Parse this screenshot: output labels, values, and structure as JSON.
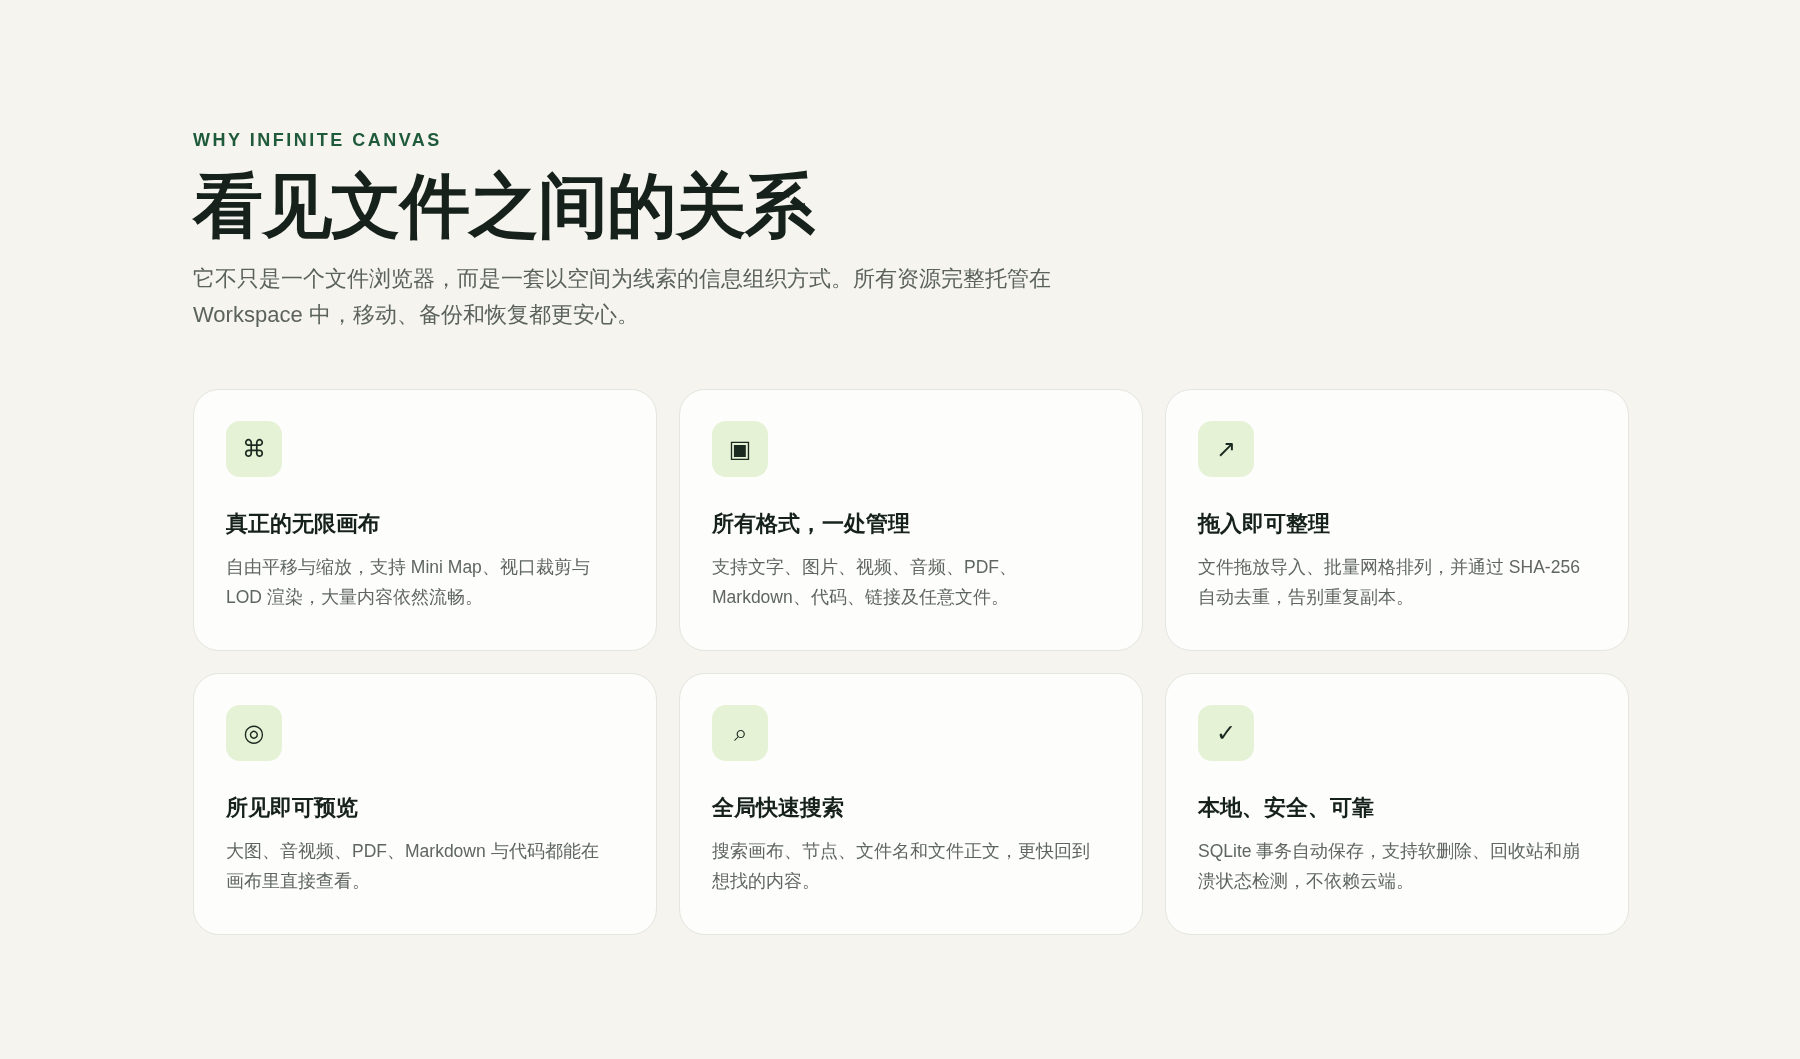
{
  "eyebrow": "WHY INFINITE CANVAS",
  "title": "看见文件之间的关系",
  "description": "它不只是一个文件浏览器，而是一套以空间为线索的信息组织方式。所有资源完整托管在 Workspace 中，移动、备份和恢复都更安心。",
  "features": [
    {
      "icon": "⌘",
      "title": "真正的无限画布",
      "text": "自由平移与缩放，支持 Mini Map、视口裁剪与 LOD 渲染，大量内容依然流畅。"
    },
    {
      "icon": "▣",
      "title": "所有格式，一处管理",
      "text": "支持文字、图片、视频、音频、PDF、Markdown、代码、链接及任意文件。"
    },
    {
      "icon": "↗",
      "title": "拖入即可整理",
      "text": "文件拖放导入、批量网格排列，并通过 SHA-256 自动去重，告别重复副本。"
    },
    {
      "icon": "◎",
      "title": "所见即可预览",
      "text": "大图、音视频、PDF、Markdown 与代码都能在画布里直接查看。"
    },
    {
      "icon": "⌕",
      "title": "全局快速搜索",
      "text": "搜索画布、节点、文件名和文件正文，更快回到想找的内容。"
    },
    {
      "icon": "✓",
      "title": "本地、安全、可靠",
      "text": "SQLite 事务自动保存，支持软删除、回收站和崩溃状态检测，不依赖云端。"
    }
  ]
}
